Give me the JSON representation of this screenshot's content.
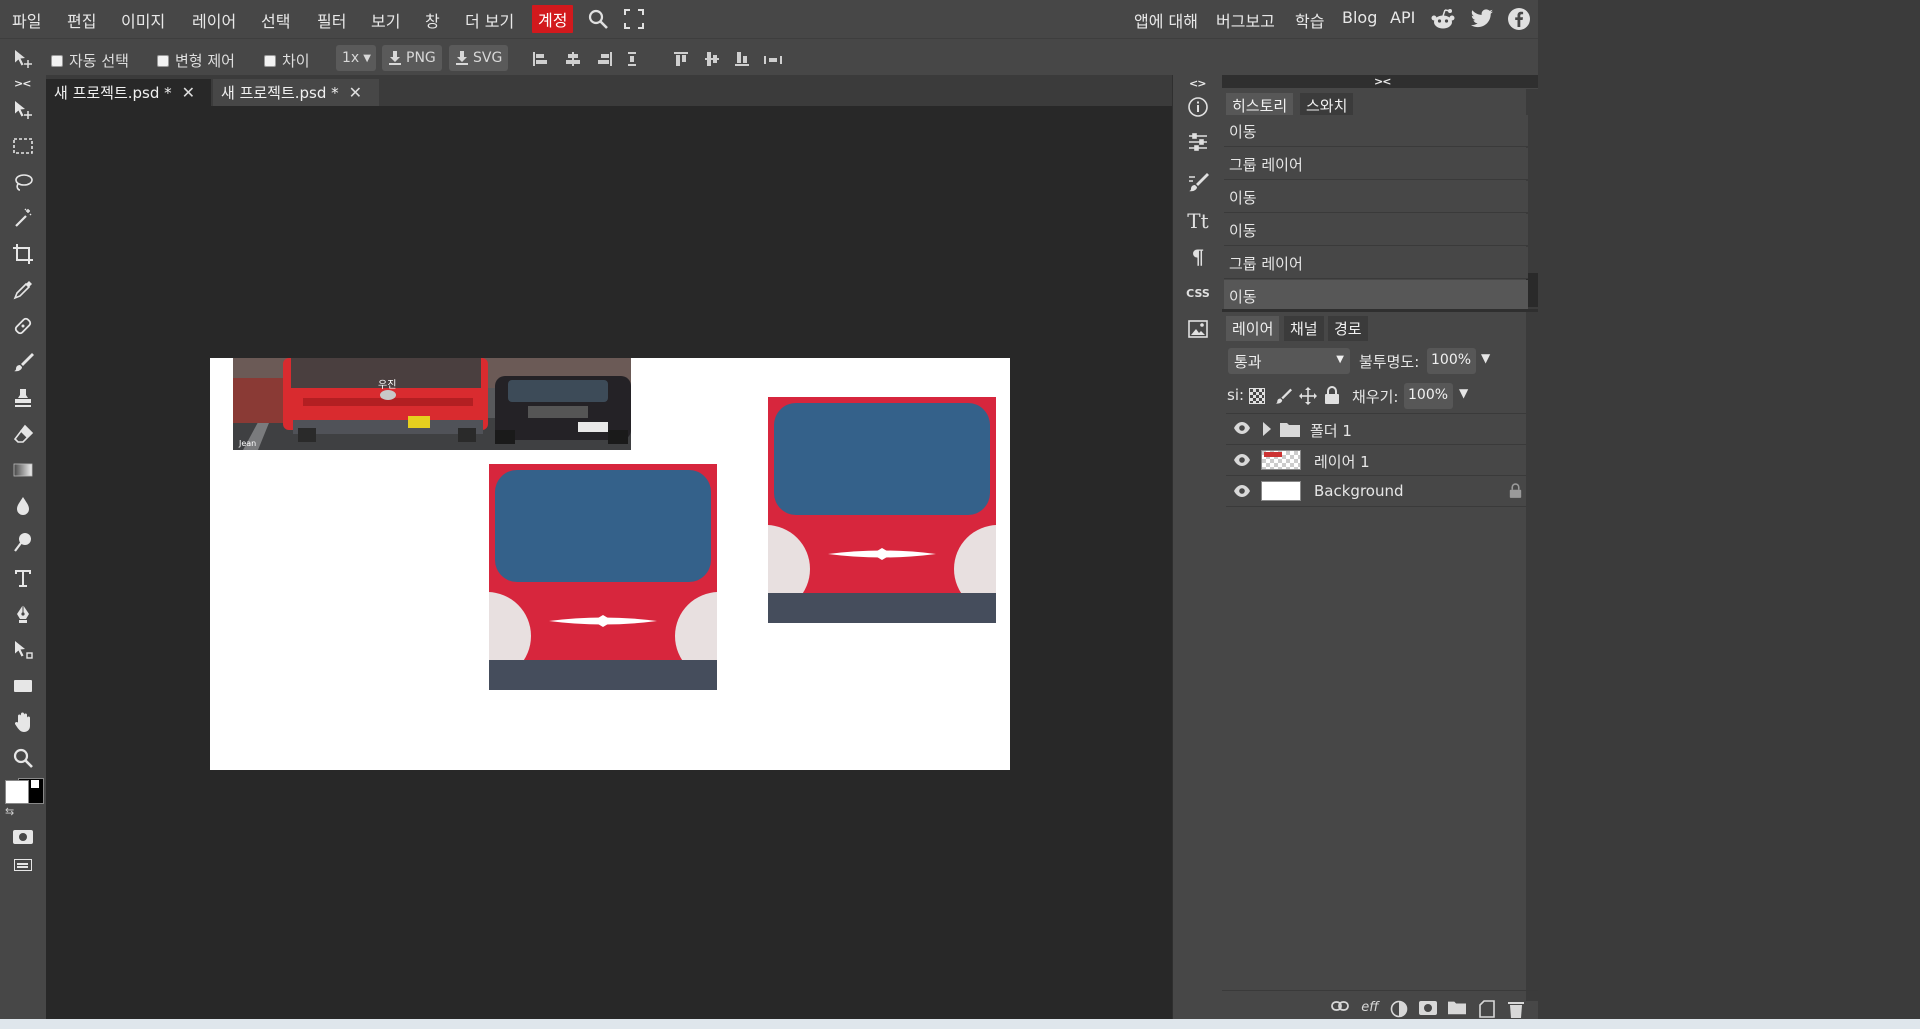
{
  "menu": {
    "items": [
      "파일",
      "편집",
      "이미지",
      "레이어",
      "선택",
      "필터",
      "보기",
      "창",
      "더 보기"
    ],
    "account": "계정",
    "right_links": [
      "앱에 대해",
      "버그보고",
      "학습",
      "Blog",
      "API"
    ],
    "icons": [
      "search-icon",
      "fullscreen-icon",
      "reddit-icon",
      "twitter-icon",
      "facebook-icon"
    ]
  },
  "options": {
    "auto_select": "자동 선택",
    "transform": "변형 제어",
    "distance": "차이",
    "scale": "1x",
    "png": "PNG",
    "svg": "SVG"
  },
  "tabs": [
    {
      "label": "새 프로젝트.psd *",
      "active": true
    },
    {
      "label": "새 프로젝트.psd *",
      "active": false
    }
  ],
  "history": {
    "tab_history": "히스토리",
    "tab_swatches": "스와치",
    "items": [
      "이동",
      "그룹 레이어",
      "이동",
      "이동",
      "그룹 레이어",
      "이동"
    ]
  },
  "layers": {
    "tab_layers": "레이어",
    "tab_channels": "채널",
    "tab_paths": "경로",
    "blend_mode": "통과",
    "opacity_label": "불투명도:",
    "opacity_value": "100%",
    "lock_label": "si:",
    "fill_label": "채우기:",
    "fill_value": "100%",
    "items": [
      {
        "name": "폴더 1",
        "type": "folder"
      },
      {
        "name": "레이어 1",
        "type": "layer"
      },
      {
        "name": "Background",
        "type": "background",
        "locked": true
      }
    ],
    "footer_eff": "eff"
  },
  "canvas": {
    "bus_plate": "우진",
    "watermark": "Jean"
  },
  "colors": {
    "accent": "#d2191d",
    "bus_red": "#d7263d",
    "window_blue": "#34618a",
    "bumper": "#454d5c",
    "wheel": "#e8e0e0"
  }
}
